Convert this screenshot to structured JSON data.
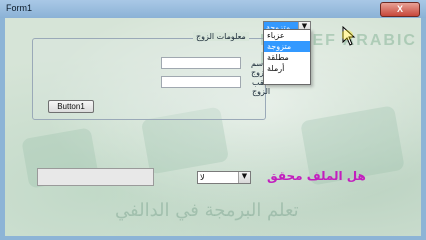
{
  "window": {
    "title": "Form1",
    "close_label": "X"
  },
  "watermark": {
    "brand": "ELGREF ARABIC ED",
    "bottom": "تعلم البرمجة في الدالفي"
  },
  "group": {
    "legend": "معلومات الزوج",
    "first_name_label": "اسم الزوج",
    "first_name_value": "",
    "last_name_label": "لقب الزوج",
    "last_name_value": "",
    "button_label": "Button1"
  },
  "status_combo": {
    "selected": "متزوجة",
    "options": [
      "عزباء",
      "متزوجة",
      "مطلقة",
      "أرملة"
    ],
    "highlighted_index": 1
  },
  "question": {
    "label": "هل الملف محقق",
    "combo_value": "لا"
  },
  "readonly_field": {
    "value": ""
  }
}
